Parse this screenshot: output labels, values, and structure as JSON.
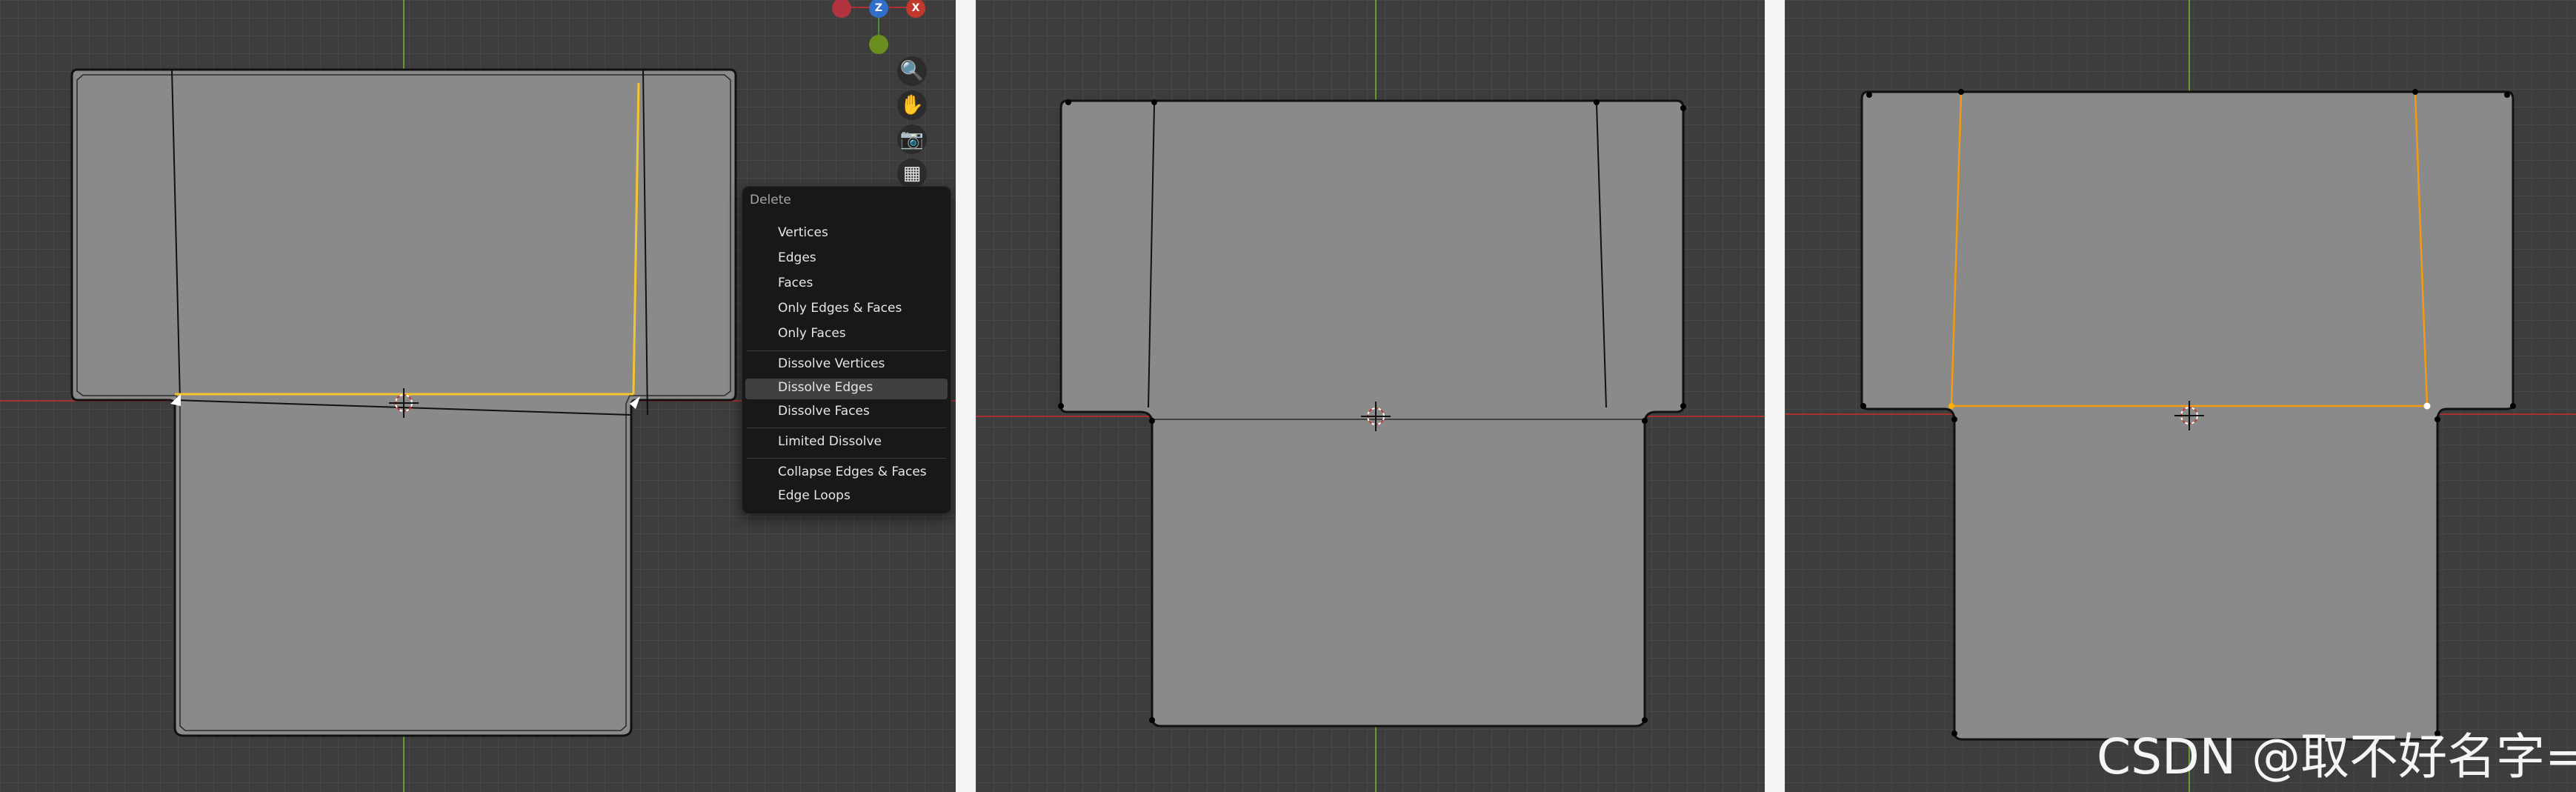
{
  "viewport": {
    "gizmo": {
      "z_label": "Z",
      "x_label": "X"
    }
  },
  "menu": {
    "title": "Delete",
    "items": [
      "Vertices",
      "Edges",
      "Faces",
      "Only Edges & Faces",
      "Only Faces",
      "Dissolve Vertices",
      "Dissolve Edges",
      "Dissolve Faces",
      "Limited Dissolve",
      "Collapse Edges & Faces",
      "Edge Loops"
    ],
    "selected": "Dissolve Edges"
  },
  "navigation_icons": [
    "zoom-icon",
    "hand-icon",
    "camera-icon",
    "grid-icon"
  ],
  "watermark": "CSDN @取不好名字=",
  "colors": {
    "background": "#3d3d3d",
    "mesh": "#8a8a8a",
    "selected_edge": "#f4c430",
    "selected_edge_orange": "#f39c12",
    "x_axis": "#c0392b",
    "y_axis": "#7cb342"
  }
}
